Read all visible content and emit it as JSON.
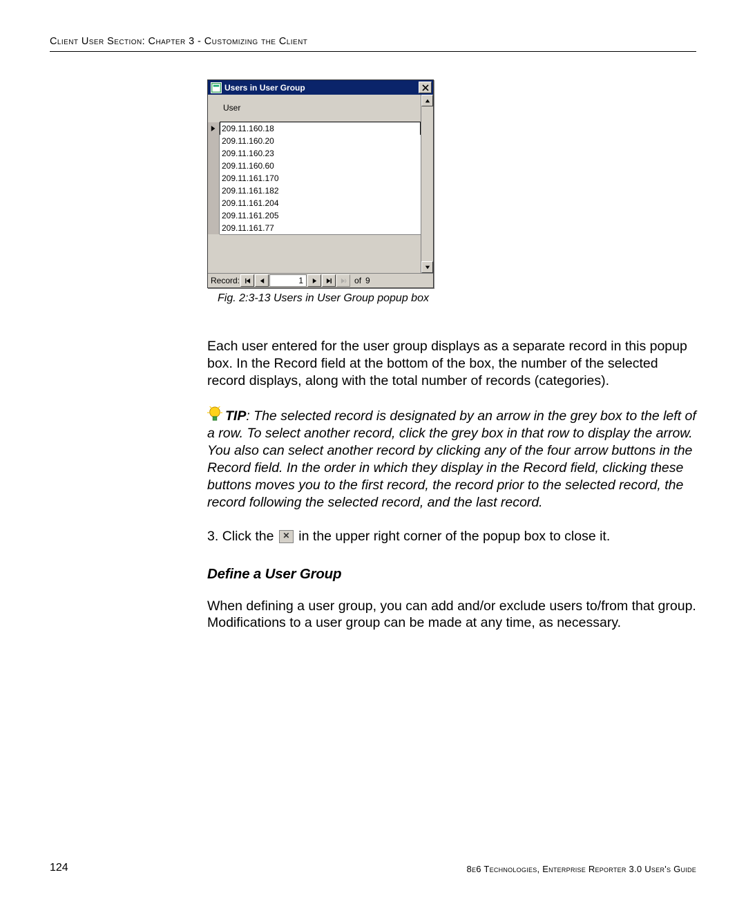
{
  "header": {
    "running_head": "Client User Section: Chapter 3 - Customizing the Client"
  },
  "popup": {
    "title": "Users in User Group",
    "column_header": "User",
    "rows": [
      "209.11.160.18",
      "209.11.160.20",
      "209.11.160.23",
      "209.11.160.60",
      "209.11.161.170",
      "209.11.161.182",
      "209.11.161.204",
      "209.11.161.205",
      "209.11.161.77"
    ],
    "selected_index": 0,
    "record_label": "Record:",
    "record_current": "1",
    "record_of_label": "of",
    "record_total": "9"
  },
  "figure_caption": "Fig. 2:3-13  Users in User Group popup box",
  "paragraph_1": "Each user entered for the user group displays as a separate record in this popup box. In the Record field at the bottom of the box, the number of the selected record displays, along with the total number of records (categories).",
  "tip_label": "TIP",
  "tip_text": ": The selected record is designated by an arrow in the grey box to the left of a row. To select another record, click the grey box in that row to display the arrow. You also can select another record by clicking any of the four arrow buttons in the Record field. In the order in which they display in the Record field, clicking these buttons moves you to the first record, the record prior to the selected record, the record following the selected record, and the last record.",
  "step3_num": "3.",
  "step3_a": "Click the ",
  "step3_b": " in the upper right corner of the popup box to close it.",
  "heading_define": "Define a User Group",
  "paragraph_2": "When defining a user group, you can add and/or exclude users to/from that group. Modifications to a user group can be made at any time, as necessary.",
  "footer": {
    "page_number": "124",
    "footer_text": "8e6 Technologies, Enterprise Reporter 3.0 User's Guide"
  }
}
